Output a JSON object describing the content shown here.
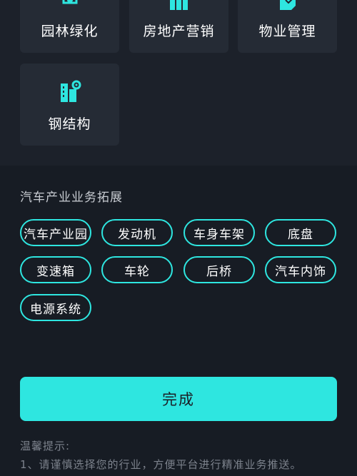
{
  "industry_tiles": [
    {
      "label": "园林绿化",
      "icon": "garden-icon"
    },
    {
      "label": "房地产营销",
      "icon": "real-estate-icon"
    },
    {
      "label": "物业管理",
      "icon": "property-icon"
    },
    {
      "label": "钢结构",
      "icon": "steel-building-icon"
    }
  ],
  "section": {
    "title": "汽车产业业务拓展",
    "tags": [
      "汽车产业园",
      "发动机",
      "车身车架",
      "底盘",
      "变速箱",
      "车轮",
      "后桥",
      "汽车内饰",
      "电源系统"
    ]
  },
  "done_button": {
    "label": "完成"
  },
  "tips": {
    "title": "温馨提示:",
    "line1": "1、请谨慎选择您的行业，方便平台进行精准业务推送。"
  },
  "colors": {
    "accent": "#2ee6e0",
    "background": "#171c24",
    "tile": "#252b35"
  }
}
